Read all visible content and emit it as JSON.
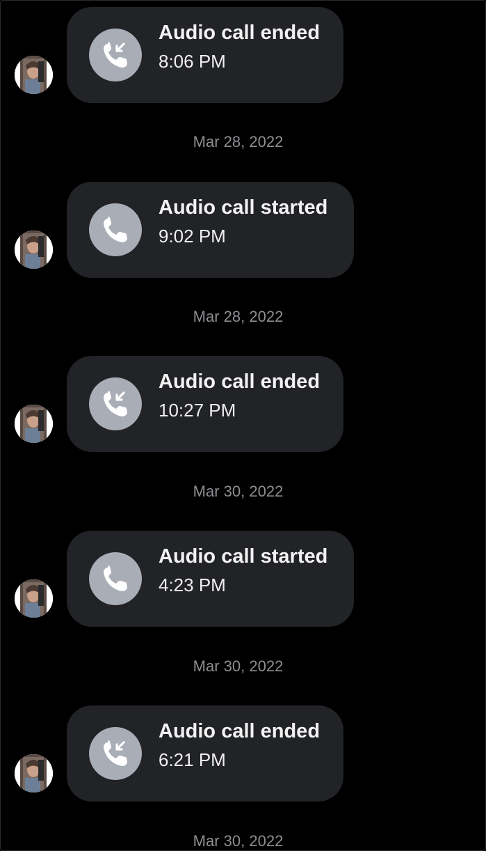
{
  "messages": [
    {
      "type": "ended",
      "icon": "incoming-call-icon",
      "title": "Audio call ended",
      "time": "8:06 PM"
    },
    {
      "type": "started",
      "icon": "phone-icon",
      "title": "Audio call started",
      "time": "9:02 PM"
    },
    {
      "type": "ended",
      "icon": "incoming-call-icon",
      "title": "Audio call ended",
      "time": "10:27 PM"
    },
    {
      "type": "started",
      "icon": "phone-icon",
      "title": "Audio call started",
      "time": "4:23 PM"
    },
    {
      "type": "ended",
      "icon": "incoming-call-icon",
      "title": "Audio call ended",
      "time": "6:21 PM"
    }
  ],
  "date_separators": [
    "Mar 28, 2022",
    "Mar 28, 2022",
    "Mar 30, 2022",
    "Mar 30, 2022",
    "Mar 30, 2022"
  ],
  "colors": {
    "background": "#000000",
    "bubble": "#222327",
    "icon_circle": "#a9adb6",
    "date_text": "#8e8e93"
  }
}
